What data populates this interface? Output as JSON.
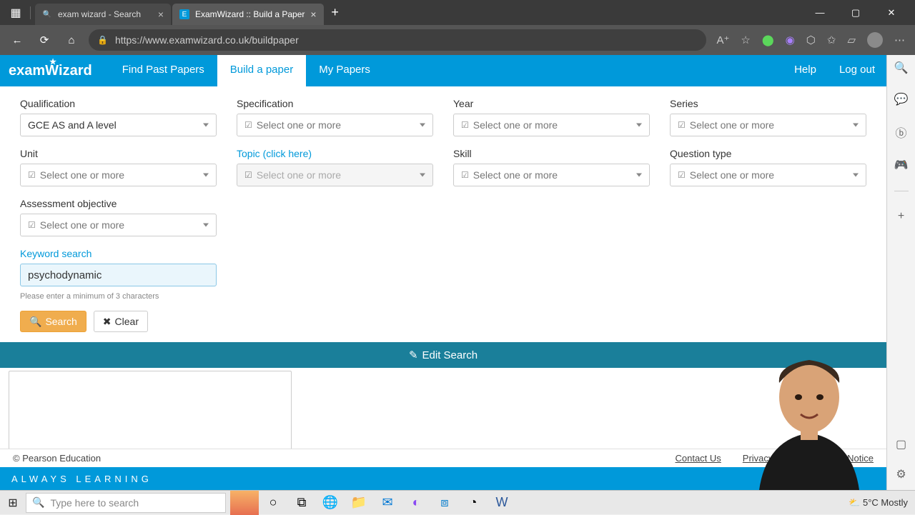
{
  "browser": {
    "tabs": [
      {
        "title": "exam wizard - Search",
        "active": false
      },
      {
        "title": "ExamWizard :: Build a Paper",
        "active": true
      }
    ],
    "url": "https://www.examwizard.co.uk/buildpaper"
  },
  "nav": {
    "logo": "examWizard",
    "items": [
      "Find Past Papers",
      "Build a paper",
      "My Papers"
    ],
    "active_index": 1,
    "right": [
      "Help",
      "Log out"
    ]
  },
  "filters": {
    "qualification": {
      "label": "Qualification",
      "value": "GCE AS and A level",
      "placeholder": ""
    },
    "specification": {
      "label": "Specification",
      "placeholder": "Select one or more"
    },
    "year": {
      "label": "Year",
      "placeholder": "Select one or more"
    },
    "series": {
      "label": "Series",
      "placeholder": "Select one or more"
    },
    "unit": {
      "label": "Unit",
      "placeholder": "Select one or more"
    },
    "topic": {
      "label": "Topic (click here)",
      "placeholder": "Select one or more"
    },
    "skill": {
      "label": "Skill",
      "placeholder": "Select one or more"
    },
    "question_type": {
      "label": "Question type",
      "placeholder": "Select one or more"
    },
    "assessment_objective": {
      "label": "Assessment objective",
      "placeholder": "Select one or more"
    },
    "keyword": {
      "label": "Keyword search",
      "value": "psychodynamic",
      "hint": "Please enter a minimum of 3 characters"
    }
  },
  "buttons": {
    "search": "Search",
    "clear": "Clear",
    "edit_search": "Edit Search"
  },
  "footer": {
    "copyright": "© Pearson Education",
    "links": [
      "Contact Us",
      "Privacy Policy",
      "Legal Notice"
    ],
    "tagline": "ALWAYS LEARNING"
  },
  "taskbar": {
    "search_placeholder": "Type here to search",
    "weather": "5°C  Mostly"
  }
}
